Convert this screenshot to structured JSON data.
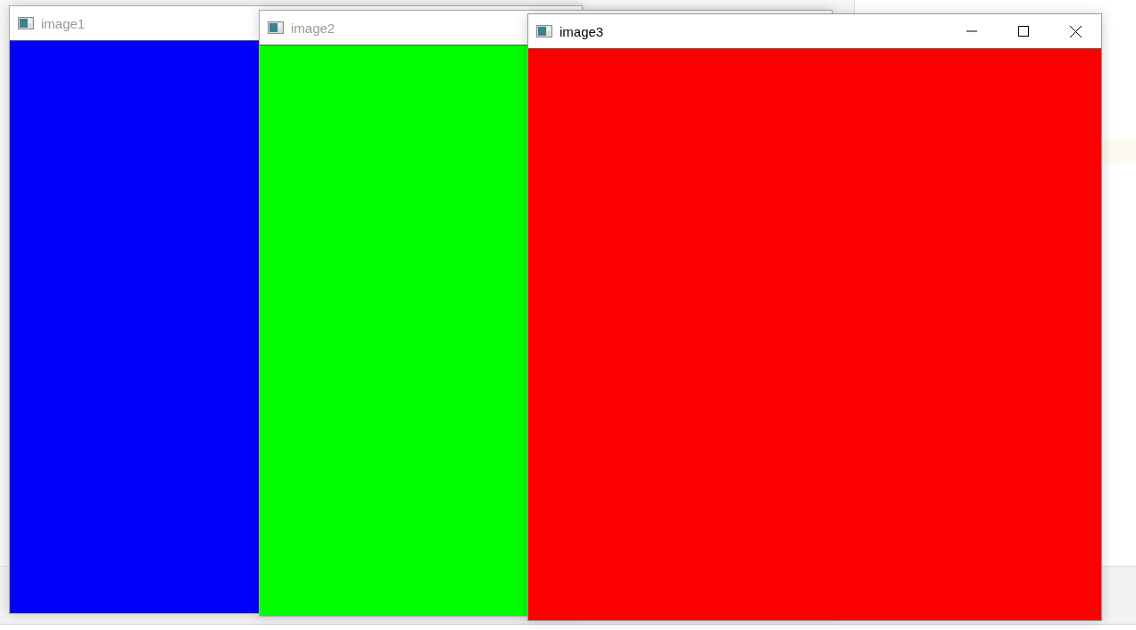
{
  "windows": [
    {
      "title": "image1",
      "active": false,
      "color": "#0000ff"
    },
    {
      "title": "image2",
      "active": false,
      "color": "#00ff00"
    },
    {
      "title": "image3",
      "active": true,
      "color": "#ff0000"
    }
  ]
}
